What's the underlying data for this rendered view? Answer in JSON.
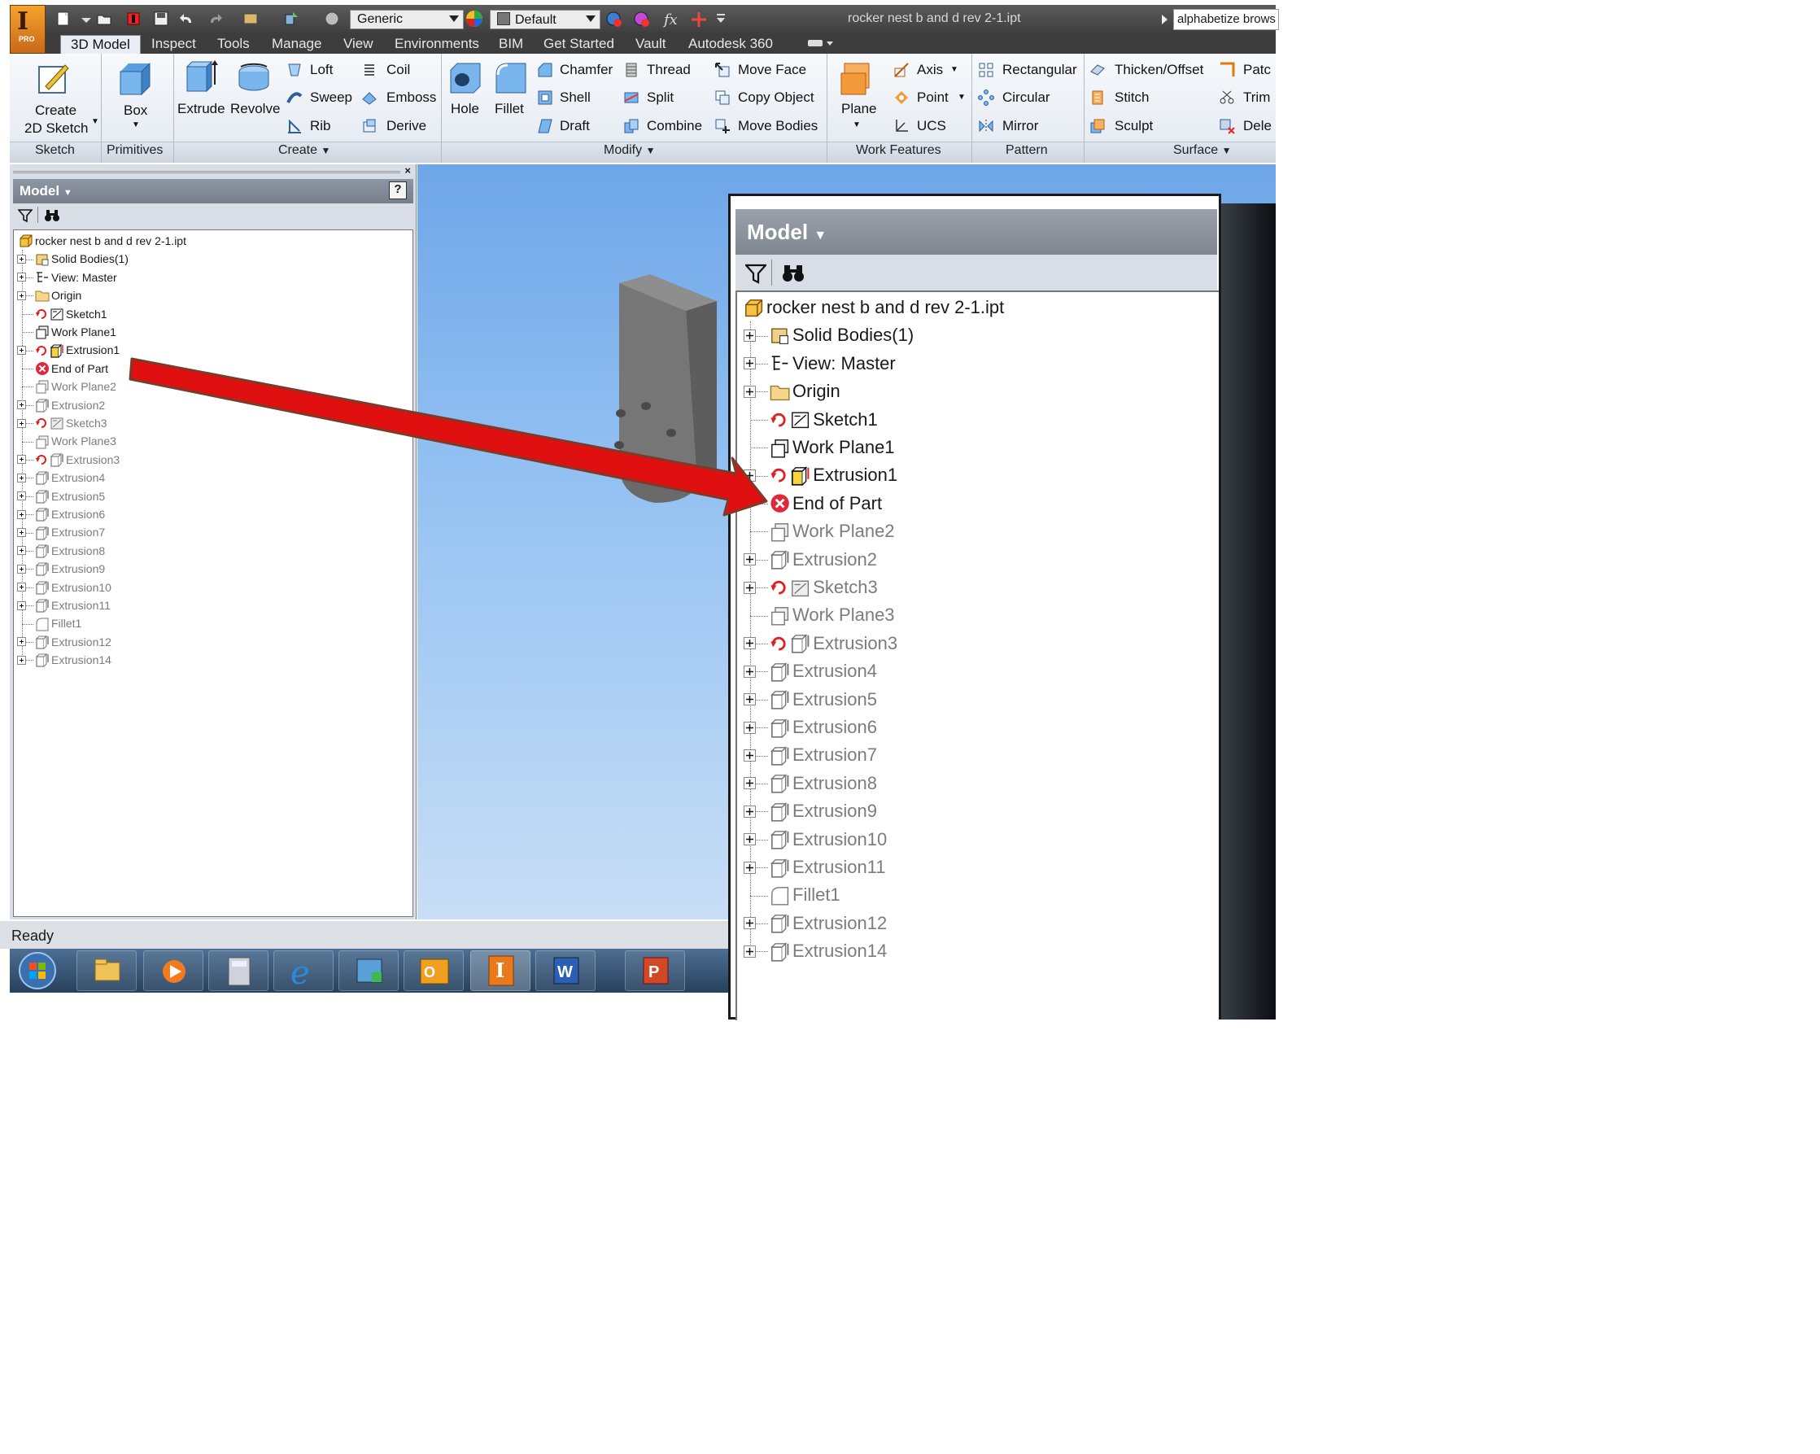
{
  "window": {
    "app_letter": "I",
    "app_badge": "PRO",
    "title": "rocker nest b and d rev 2-1.ipt",
    "search_text": "alphabetize brows",
    "material_dropdown": "Generic",
    "appearance_dropdown": "Default"
  },
  "tabs": [
    "3D Model",
    "Inspect",
    "Tools",
    "Manage",
    "View",
    "Environments",
    "BIM",
    "Get Started",
    "Vault",
    "Autodesk 360"
  ],
  "ribbon": {
    "sketch": {
      "create_label_1": "Create",
      "create_label_2": "2D Sketch",
      "panel": "Sketch"
    },
    "primitives": {
      "box_label": "Box",
      "panel": "Primitives"
    },
    "create": {
      "extrude": "Extrude",
      "revolve": "Revolve",
      "loft": "Loft",
      "sweep": "Sweep",
      "rib": "Rib",
      "coil": "Coil",
      "emboss": "Emboss",
      "derive": "Derive",
      "panel": "Create"
    },
    "modify": {
      "hole": "Hole",
      "fillet": "Fillet",
      "chamfer": "Chamfer",
      "shell": "Shell",
      "draft": "Draft",
      "thread": "Thread",
      "split": "Split",
      "combine": "Combine",
      "move_face": "Move Face",
      "copy_object": "Copy Object",
      "move_bodies": "Move Bodies",
      "panel": "Modify"
    },
    "work_features": {
      "plane": "Plane",
      "axis": "Axis",
      "point": "Point",
      "ucs": "UCS",
      "panel": "Work Features"
    },
    "pattern": {
      "rectangular": "Rectangular",
      "circular": "Circular",
      "mirror": "Mirror",
      "panel": "Pattern"
    },
    "surface": {
      "thicken": "Thicken/Offset",
      "stitch": "Stitch",
      "sculpt": "Sculpt",
      "patch": "Patc",
      "trim": "Trim",
      "delete": "Dele",
      "panel": "Surface"
    }
  },
  "browser": {
    "title": "Model",
    "tree": [
      {
        "label": "rocker nest b and d rev 2-1.ipt",
        "indent": 0,
        "expand": false,
        "icon": "part-icon",
        "dim": false,
        "sick": false
      },
      {
        "label": "Solid Bodies(1)",
        "indent": 1,
        "expand": true,
        "icon": "solid-bodies-icon",
        "dim": false,
        "sick": false
      },
      {
        "label": "View: Master",
        "indent": 1,
        "expand": true,
        "icon": "view-rep-icon",
        "dim": false,
        "sick": false
      },
      {
        "label": "Origin",
        "indent": 1,
        "expand": true,
        "icon": "folder-icon",
        "dim": false,
        "sick": false
      },
      {
        "label": "Sketch1",
        "indent": 1,
        "expand": false,
        "icon": "sketch-icon",
        "dim": false,
        "sick": true
      },
      {
        "label": "Work Plane1",
        "indent": 1,
        "expand": false,
        "icon": "work-plane-icon",
        "dim": false,
        "sick": false
      },
      {
        "label": "Extrusion1",
        "indent": 1,
        "expand": true,
        "icon": "extrusion-icon",
        "dim": false,
        "sick": true,
        "highlight": true
      },
      {
        "label": "End of Part",
        "indent": 1,
        "expand": false,
        "icon": "end-of-part-icon",
        "dim": false,
        "sick": false
      },
      {
        "label": "Work Plane2",
        "indent": 1,
        "expand": false,
        "icon": "work-plane-icon",
        "dim": true,
        "sick": false
      },
      {
        "label": "Extrusion2",
        "indent": 1,
        "expand": true,
        "icon": "extrusion-icon",
        "dim": true,
        "sick": false
      },
      {
        "label": "Sketch3",
        "indent": 1,
        "expand": true,
        "icon": "sketch-icon",
        "dim": true,
        "sick": true
      },
      {
        "label": "Work Plane3",
        "indent": 1,
        "expand": false,
        "icon": "work-plane-icon",
        "dim": true,
        "sick": false
      },
      {
        "label": "Extrusion3",
        "indent": 1,
        "expand": true,
        "icon": "extrusion-icon",
        "dim": true,
        "sick": true
      },
      {
        "label": "Extrusion4",
        "indent": 1,
        "expand": true,
        "icon": "extrusion-icon",
        "dim": true,
        "sick": false
      },
      {
        "label": "Extrusion5",
        "indent": 1,
        "expand": true,
        "icon": "extrusion-icon",
        "dim": true,
        "sick": false
      },
      {
        "label": "Extrusion6",
        "indent": 1,
        "expand": true,
        "icon": "extrusion-icon",
        "dim": true,
        "sick": false
      },
      {
        "label": "Extrusion7",
        "indent": 1,
        "expand": true,
        "icon": "extrusion-icon",
        "dim": true,
        "sick": false
      },
      {
        "label": "Extrusion8",
        "indent": 1,
        "expand": true,
        "icon": "extrusion-icon",
        "dim": true,
        "sick": false
      },
      {
        "label": "Extrusion9",
        "indent": 1,
        "expand": true,
        "icon": "extrusion-icon",
        "dim": true,
        "sick": false
      },
      {
        "label": "Extrusion10",
        "indent": 1,
        "expand": true,
        "icon": "extrusion-icon",
        "dim": true,
        "sick": false
      },
      {
        "label": "Extrusion11",
        "indent": 1,
        "expand": true,
        "icon": "extrusion-icon",
        "dim": true,
        "sick": false
      },
      {
        "label": "Fillet1",
        "indent": 1,
        "expand": false,
        "icon": "fillet-icon",
        "dim": true,
        "sick": false
      },
      {
        "label": "Extrusion12",
        "indent": 1,
        "expand": true,
        "icon": "extrusion-icon",
        "dim": true,
        "sick": false
      },
      {
        "label": "Extrusion14",
        "indent": 1,
        "expand": true,
        "icon": "extrusion-icon",
        "dim": true,
        "sick": false
      }
    ]
  },
  "status": {
    "text": "Ready"
  },
  "taskbar": [
    "start-orb-icon",
    "file-explorer-icon",
    "media-player-icon",
    "calculator-icon",
    "internet-explorer-icon",
    "network-icon",
    "outlook-icon",
    "inventor-icon",
    "word-icon",
    "powerpoint-icon"
  ],
  "colors": {
    "ribbon_bg": "#e3e9f1",
    "viewport_sky": "#92c0f2",
    "arrow_red": "#e01010",
    "arrow_outline": "#7a3b2a",
    "dim_text": "#7c7c7c",
    "sick_icon": "#e02020"
  }
}
